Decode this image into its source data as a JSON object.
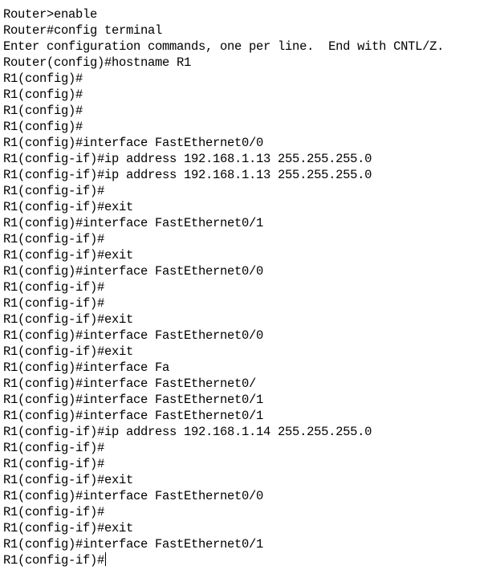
{
  "terminal": {
    "lines": [
      "Router>enable",
      "Router#config terminal",
      "Enter configuration commands, one per line.  End with CNTL/Z.",
      "Router(config)#hostname R1",
      "R1(config)#",
      "R1(config)#",
      "R1(config)#",
      "R1(config)#",
      "R1(config)#interface FastEthernet0/0",
      "R1(config-if)#ip address 192.168.1.13 255.255.255.0",
      "R1(config-if)#ip address 192.168.1.13 255.255.255.0",
      "R1(config-if)#",
      "R1(config-if)#exit",
      "R1(config)#interface FastEthernet0/1",
      "R1(config-if)#",
      "R1(config-if)#exit",
      "R1(config)#interface FastEthernet0/0",
      "R1(config-if)#",
      "R1(config-if)#",
      "R1(config-if)#exit",
      "R1(config)#interface FastEthernet0/0",
      "R1(config-if)#exit",
      "R1(config)#interface Fa",
      "R1(config)#interface FastEthernet0/",
      "R1(config)#interface FastEthernet0/1",
      "R1(config)#interface FastEthernet0/1",
      "R1(config-if)#ip address 192.168.1.14 255.255.255.0",
      "R1(config-if)#",
      "R1(config-if)#",
      "R1(config-if)#exit",
      "R1(config)#interface FastEthernet0/0",
      "R1(config-if)#",
      "R1(config-if)#exit",
      "R1(config)#interface FastEthernet0/1"
    ],
    "prompt": "R1(config-if)#"
  }
}
